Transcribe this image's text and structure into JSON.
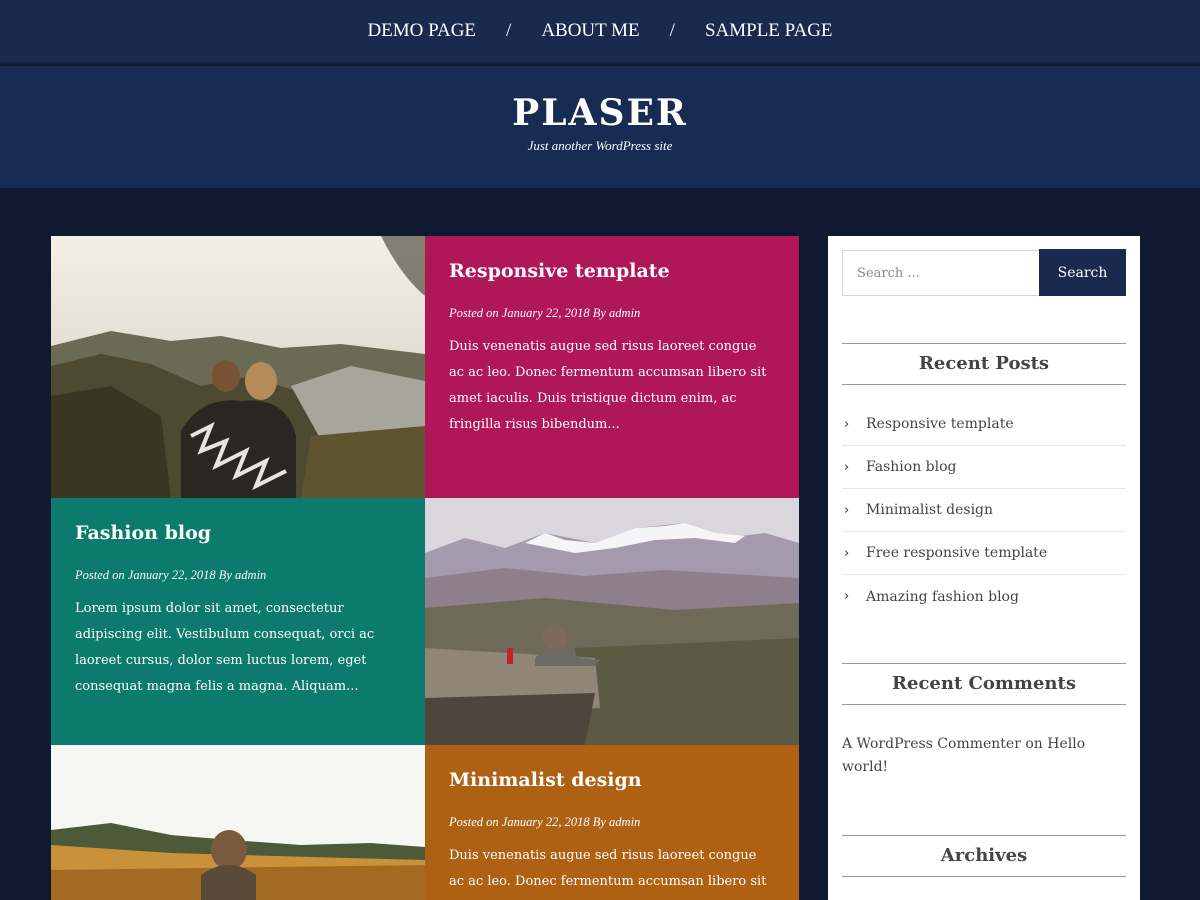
{
  "nav": {
    "items": [
      "DEMO PAGE",
      "ABOUT ME",
      "SAMPLE PAGE"
    ],
    "separator": "/"
  },
  "site": {
    "title": "PLASER",
    "description": "Just another WordPress site"
  },
  "posts": [
    {
      "title": "Responsive template",
      "meta": "Posted on January 22, 2018  By admin",
      "excerpt": "Duis venenatis augue sed risus laoreet congue ac ac leo. Donec fermentum accumsan libero sit amet iaculis. Duis tristique dictum enim, ac fringilla risus bibendum...",
      "color": "#b01758"
    },
    {
      "title": "Fashion blog",
      "meta": "Posted on January 22, 2018  By admin",
      "excerpt": "Lorem ipsum dolor sit amet, consectetur adipiscing elit. Vestibulum consequat, orci ac laoreet cursus, dolor sem luctus lorem, eget consequat magna felis a magna. Aliquam...",
      "color": "#0c7a6c"
    },
    {
      "title": "Minimalist design",
      "meta": "Posted on January 22, 2018  By admin",
      "excerpt": "Duis venenatis augue sed risus laoreet congue ac ac leo. Donec fermentum accumsan libero sit",
      "color": "#ae6112"
    }
  ],
  "sidebar": {
    "search": {
      "placeholder": "Search ...",
      "button": "Search"
    },
    "recent_posts": {
      "title": "Recent Posts",
      "items": [
        "Responsive template",
        "Fashion blog",
        "Minimalist design",
        "Free responsive template",
        "Amazing fashion blog"
      ]
    },
    "recent_comments": {
      "title": "Recent Comments",
      "author": "A WordPress Commenter",
      "connector": "on",
      "post": "Hello world!"
    },
    "archives": {
      "title": "Archives"
    }
  },
  "colors": {
    "nav_bg": "#192a4e",
    "header_bg": "#182b52",
    "page_bg": "#0f1a30",
    "search_button": "#192a4e"
  }
}
